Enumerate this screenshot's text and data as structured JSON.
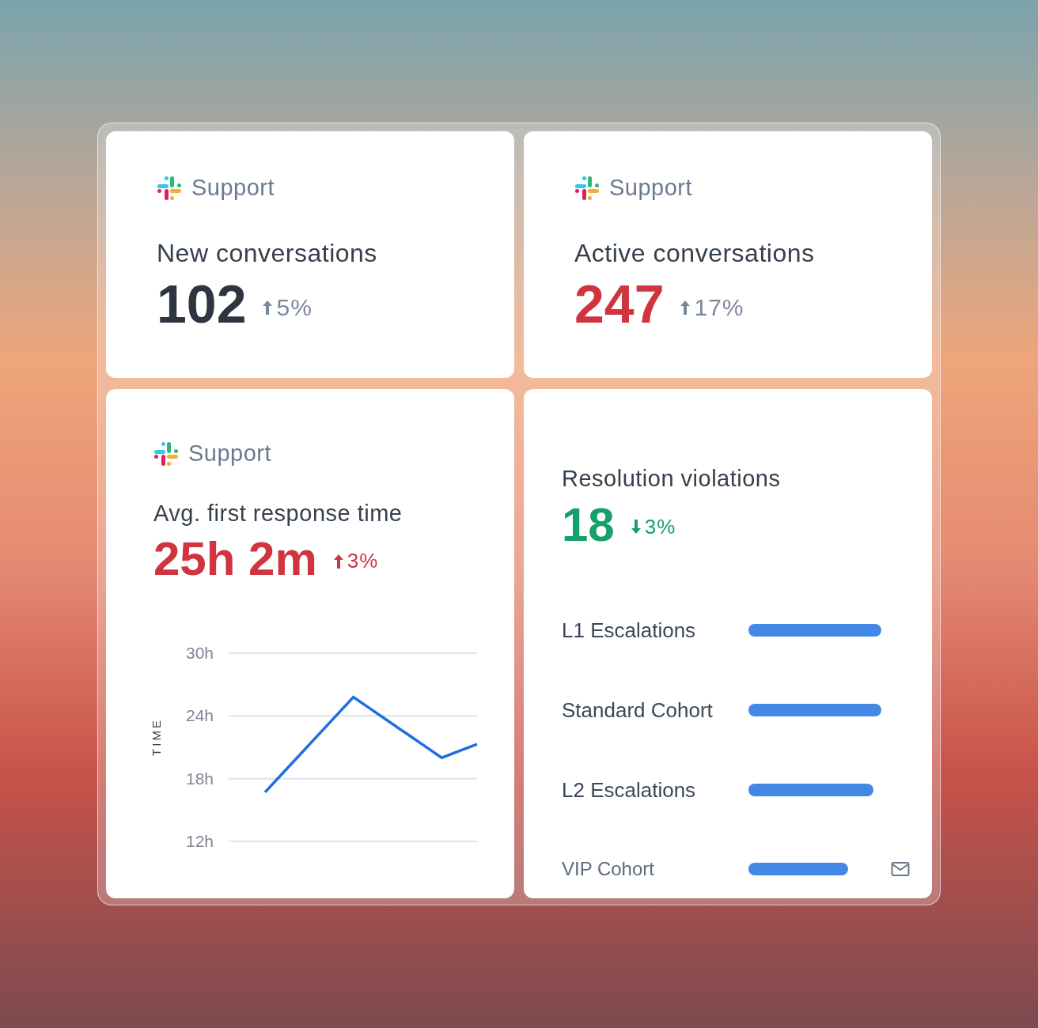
{
  "cards": [
    {
      "kind": "metric",
      "source": "Support",
      "title": "New conversations",
      "value": {
        "text": "102",
        "color": "#2e3540"
      },
      "change": {
        "text": "5%",
        "rising": true,
        "color": "#7b889b"
      }
    },
    {
      "kind": "metric",
      "source": "Support",
      "title": "Active conversations",
      "value": {
        "text": "247",
        "color": "#d0343f"
      },
      "change": {
        "text": "17%",
        "rising": true,
        "color": "#7b889b"
      }
    },
    {
      "kind": "chart",
      "source": "Support",
      "title": "Avg. first response time",
      "value": {
        "text": "25h 2m",
        "color": "#d0343f"
      },
      "change": {
        "text": "3%",
        "rising": true,
        "color": "#d0343f"
      },
      "chart_data": {
        "type": "line",
        "ylabel": "TIME",
        "categories": [
          null,
          null,
          null,
          null,
          null,
          null,
          null,
          null,
          null,
          null,
          null,
          null,
          null
        ],
        "ylim": [
          12,
          30
        ],
        "yticks": [
          {
            "value": 30,
            "label": "30h"
          },
          {
            "value": 24,
            "label": "24h"
          },
          {
            "value": 18,
            "label": "18h"
          },
          {
            "value": 12,
            "label": "12h"
          }
        ],
        "series": [
          {
            "color": "#1f6fe0",
            "values": [
              16.7,
              18.52,
              20.34,
              22.16,
              23.98,
              25.8,
              24.64,
              23.48,
              22.32,
              21.16,
              20.0,
              20.65,
              21.3
            ]
          }
        ]
      }
    },
    {
      "kind": "bars",
      "title": "Resolution violations",
      "value": {
        "text": "18",
        "color": "#17a06a"
      },
      "change": {
        "text": "3%",
        "rising": false,
        "color": "#17a06a"
      },
      "rows": [
        {
          "label": "L1 Escalations",
          "level": 1.0,
          "mail": false
        },
        {
          "label": "Standard Cohort",
          "level": 1.0,
          "mail": false
        },
        {
          "label": "L2 Escalations",
          "level": 0.94,
          "mail": false
        },
        {
          "label": "VIP Cohort",
          "level": 0.75,
          "mail": true
        }
      ]
    }
  ]
}
